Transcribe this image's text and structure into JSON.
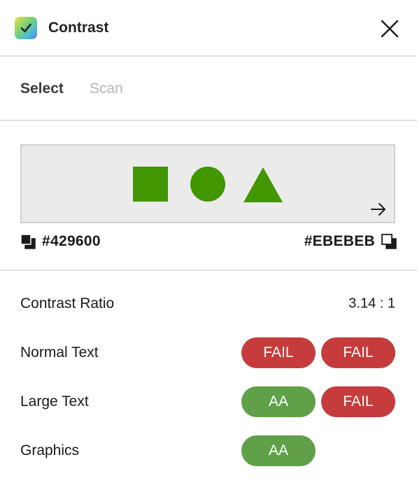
{
  "header": {
    "title": "Contrast",
    "icon": "checkmark-app-icon",
    "close_icon": "close-icon"
  },
  "tabs": [
    {
      "label": "Select",
      "active": true
    },
    {
      "label": "Scan",
      "active": false
    }
  ],
  "preview": {
    "foreground": "#429600",
    "background": "#EBEBEB",
    "shapes": [
      "square",
      "circle",
      "triangle"
    ],
    "swap_icon": "arrow-right-icon"
  },
  "colors": {
    "foreground_hex": "#429600",
    "background_hex": "#EBEBEB"
  },
  "results": {
    "contrast_ratio_label": "Contrast Ratio",
    "contrast_ratio_value": "3.14 : 1",
    "rows": [
      {
        "label": "Normal Text",
        "badges": [
          {
            "text": "FAIL",
            "status": "fail"
          },
          {
            "text": "FAIL",
            "status": "fail"
          }
        ]
      },
      {
        "label": "Large Text",
        "badges": [
          {
            "text": "AA",
            "status": "pass"
          },
          {
            "text": "FAIL",
            "status": "fail"
          }
        ]
      },
      {
        "label": "Graphics",
        "badges": [
          {
            "text": "AA",
            "status": "pass"
          }
        ]
      }
    ]
  },
  "theme": {
    "pass_color": "#5fa048",
    "fail_color": "#c63c3c",
    "sample_color": "#429600"
  }
}
